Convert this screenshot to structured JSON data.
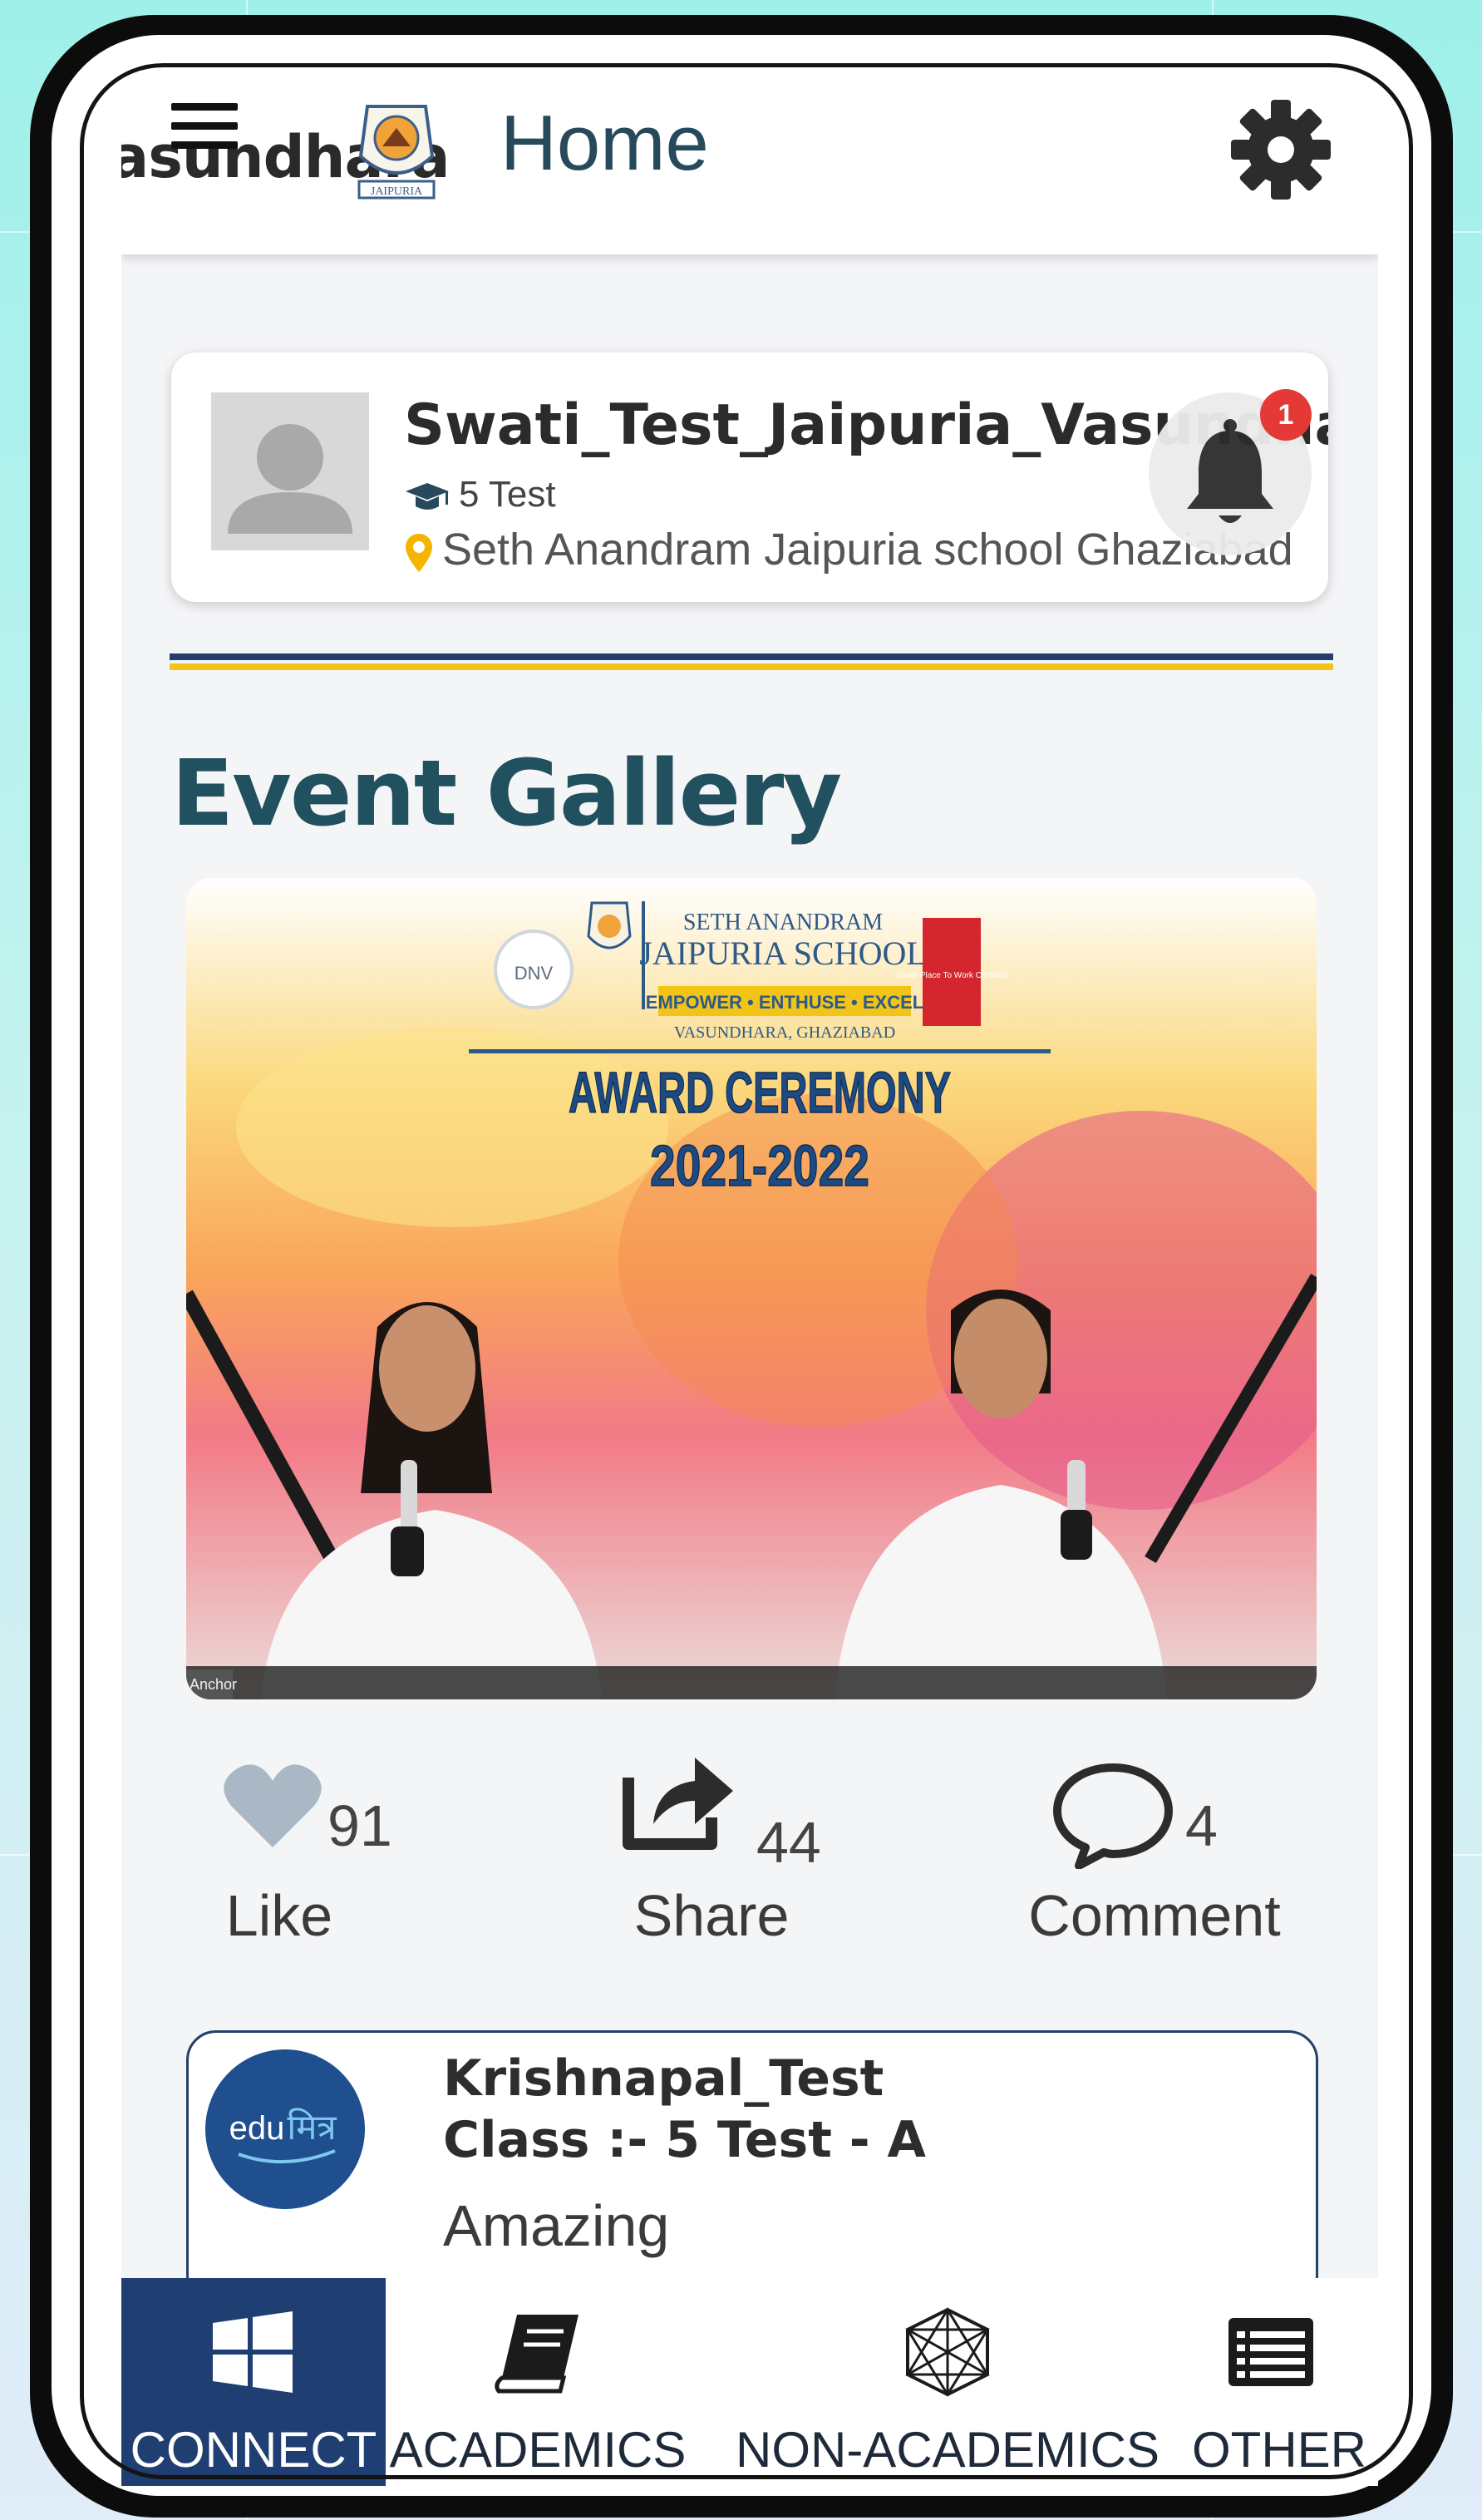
{
  "header": {
    "logo_text": "asundhara",
    "crest_caption": "JAIPURIA",
    "title": "Home",
    "settings_icon": "gear-icon",
    "menu_icon": "hamburger-icon"
  },
  "profile": {
    "name": "Swati_Test_Jaipuria_Vasundhara",
    "class": "5 Test",
    "school": "Seth Anandram Jaipuria school Ghaziabad",
    "notification_count": "1"
  },
  "gallery": {
    "section_title": "Event Gallery",
    "image": {
      "school_line1": "SETH ANANDRAM",
      "school_line2": "JAIPURIA SCHOOL",
      "motto": "EMPOWER • ENTHUSE • EXCEL",
      "location": "VASUNDHARA, GHAZIABAD",
      "heading": "AWARD CEREMONY",
      "year": "2021-2022",
      "cert_left": "DNV",
      "cert_right": "Great Place To Work Certified",
      "corner_label": "Anchor"
    }
  },
  "actions": {
    "like": {
      "count": "91",
      "label": "Like"
    },
    "share": {
      "count": "44",
      "label": "Share"
    },
    "comment": {
      "count": "4",
      "label": "Comment"
    }
  },
  "comment": {
    "avatar_text": "edu",
    "avatar_script": "मित्र",
    "name": "Krishnapal_Test",
    "class": "Class :- 5 Test - A",
    "text": "Amazing"
  },
  "bottom_nav": {
    "items": [
      {
        "label": "CONNECT",
        "icon": "windows-icon",
        "active": true
      },
      {
        "label": "ACADEMICS",
        "icon": "book-icon",
        "active": false
      },
      {
        "label": "NON-ACADEMICS",
        "icon": "polygon-icon",
        "active": false
      },
      {
        "label": "OTHER",
        "icon": "list-icon",
        "active": false
      }
    ]
  },
  "colors": {
    "accent": "#1f3f73",
    "title": "#21505e",
    "gold": "#f2c418",
    "badge": "#e53935"
  }
}
